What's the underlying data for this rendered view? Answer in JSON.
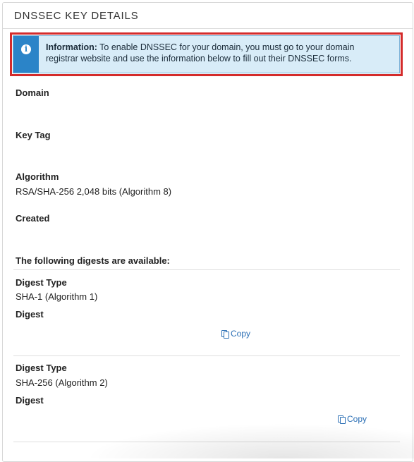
{
  "panel": {
    "title": "DNSSEC KEY DETAILS"
  },
  "alert": {
    "icon": "info-icon",
    "heading": "Information:",
    "message_line1": "To enable DNSSEC for your domain, you must go to your domain",
    "message_line2": "registrar website and use the information below to fill out their DNSSEC forms."
  },
  "fields": {
    "domain_label": "Domain",
    "key_tag_label": "Key Tag",
    "algorithm_label": "Algorithm",
    "algorithm_value": "RSA/SHA-256 2,048 bits (Algorithm 8)",
    "created_label": "Created"
  },
  "digests": {
    "heading": "The following digests are available:",
    "items": [
      {
        "type_label": "Digest Type",
        "type_value": "SHA-1 (Algorithm 1)",
        "digest_label": "Digest",
        "copy_label": "Copy"
      },
      {
        "type_label": "Digest Type",
        "type_value": "SHA-256 (Algorithm 2)",
        "digest_label": "Digest",
        "copy_label": "Copy"
      }
    ]
  },
  "colors": {
    "alert_bg": "#d8ecf8",
    "alert_accent": "#2b84c8",
    "highlight_border": "#d42b2b",
    "link": "#2b6fb5"
  }
}
